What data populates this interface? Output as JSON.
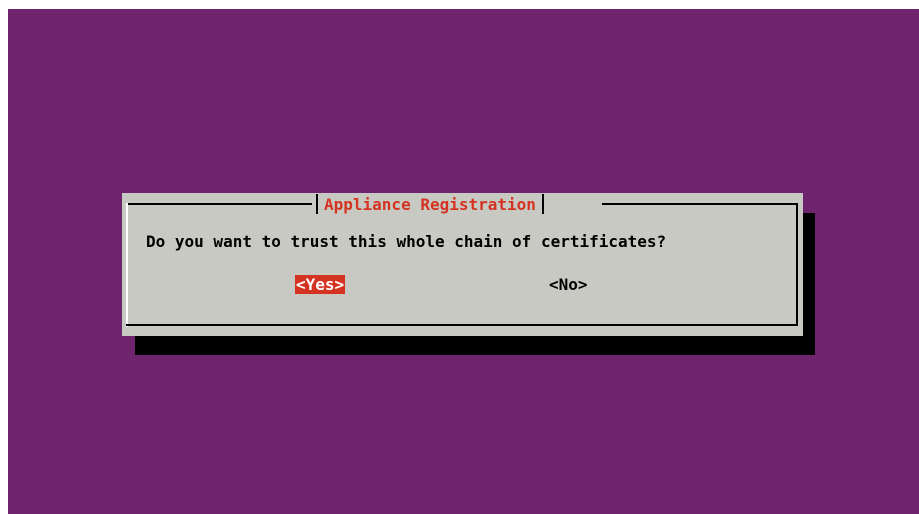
{
  "dialog": {
    "title": "Appliance Registration",
    "question": "Do you want to trust this whole chain of certificates?",
    "buttons": {
      "yes": "<Yes>",
      "no": "<No>"
    },
    "selected_button": "yes"
  },
  "colors": {
    "background": "#6f256e",
    "dialog": "#c8c9c3",
    "accent": "#d53322",
    "shadow": "#000000"
  }
}
